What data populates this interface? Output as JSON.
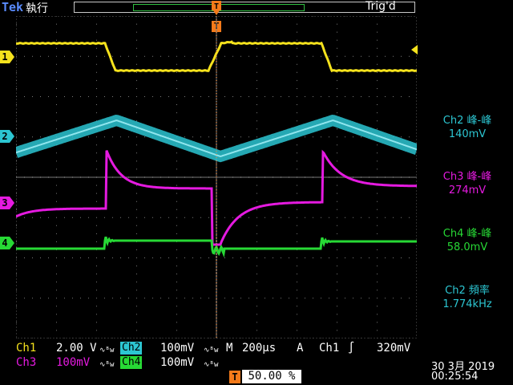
{
  "header": {
    "brand": "Tek",
    "run_state": "執行",
    "trigger_state": "Trig'd",
    "trigger_marker": "T"
  },
  "channels": [
    {
      "id": "ch1",
      "marker": "1",
      "color": "#f5e21d"
    },
    {
      "id": "ch2",
      "marker": "2",
      "color": "#2cc6d2"
    },
    {
      "id": "ch3",
      "marker": "3",
      "color": "#e51ae0"
    },
    {
      "id": "ch4",
      "marker": "4",
      "color": "#27d935"
    }
  ],
  "measurements": [
    {
      "label": "Ch2 峰-峰",
      "value": "140mV",
      "color": "#2cc6d2"
    },
    {
      "label": "Ch3 峰-峰",
      "value": "274mV",
      "color": "#e51ae0"
    },
    {
      "label": "Ch4 峰-峰",
      "value": "58.0mV",
      "color": "#27d935"
    },
    {
      "label": "Ch2 頻率",
      "value": "1.774kHz",
      "color": "#2cc6d2"
    }
  ],
  "status": {
    "ch1_label": "Ch1",
    "ch1_scale": "2.00 V",
    "ch2_label": "Ch2",
    "ch2_scale": "100mV",
    "ch3_label": "Ch3",
    "ch3_scale": "100mV",
    "ch4_label": "Ch4",
    "ch4_scale": "100mV",
    "bw_symbol": "∿ᴮw",
    "timebase_label": "M",
    "timebase_value": "200µs",
    "trigger_mode": "A",
    "trigger_source": "Ch1",
    "trigger_slope": "∫",
    "trigger_level": "320mV",
    "trigger_position_badge": "T",
    "trigger_position": "50.00 %"
  },
  "datetime": {
    "date": "30 3月  2019",
    "time": "00:25:54"
  }
}
